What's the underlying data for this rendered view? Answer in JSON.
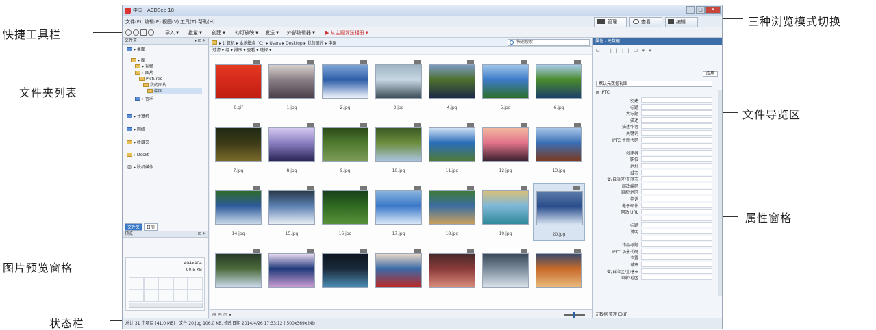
{
  "annotations": {
    "toolbar": "快捷工具栏",
    "folder_list": "文件夹列表",
    "preview_pane": "图片预览窗格",
    "status_bar": "状态栏",
    "view_mode": "三种浏览模式切换",
    "file_browser": "文件导览区",
    "properties": "属性窗格"
  },
  "window": {
    "title": "中国 - ACDSee 18",
    "minimize": "–",
    "maximize": "□",
    "close": "✕"
  },
  "menu": [
    "文件(F)",
    "编辑(E)",
    "视图(V)",
    "工具(T)",
    "帮助(H)"
  ],
  "modes": {
    "manage": "管理",
    "view": "查看",
    "edit": "编辑"
  },
  "toolbar": {
    "items": [
      "导入 ▾",
      "批量 ▾",
      "创建 ▾",
      "幻灯放映 ▾",
      "发送 ▾",
      "外部编辑器 ▾"
    ],
    "red_item": "▶ 从主题发送相册 ▾"
  },
  "left": {
    "folders_title": "文件夹",
    "tree": [
      "▸ 桌面",
      "▸ 库",
      "▸ 视频",
      "▸ 图片",
      "Pictures",
      "我的图片",
      "中国",
      "▸ 音乐",
      "▸ 计算机",
      "▸ 网络",
      "▸ 收藏夹",
      "▸ Deskt",
      "▸ 脱机媒体"
    ],
    "tabs": [
      "文件夹",
      "日历"
    ],
    "preview_title": "预览",
    "preview_meta_1": "404x404",
    "preview_meta_2": "90.5 KB"
  },
  "center": {
    "path": "▸ 计算机 ▸ 本地磁盘 (C:) ▸ Users ▸ Desktop ▸ 我的图片 ▸ 中国",
    "search_placeholder": "快速搜索",
    "filter": "过滤 ▾  组 ▾  排序 ▾  查看 ▾  选择 ▾",
    "status_icons": "⊞ ⊟ ⊡ ▾",
    "thumbnails": [
      {
        "caption": "0.gif",
        "c1": "#d62a1c",
        "c2": "#c01f12",
        "c3": "#e33a20"
      },
      {
        "caption": "1.jpg",
        "c1": "#8a7f86",
        "c2": "#4b3f4a",
        "c3": "#d6d0cc"
      },
      {
        "caption": "2.jpg",
        "c1": "#2d5ea8",
        "c2": "#f0f4fb",
        "c3": "#7fa5d8"
      },
      {
        "caption": "3.jpg",
        "c1": "#c8d7e3",
        "c2": "#3d4f59",
        "c3": "#9eb4c4"
      },
      {
        "caption": "4.jpg",
        "c1": "#4f6f2e",
        "c2": "#1a2a44",
        "c3": "#7a9ac2"
      },
      {
        "caption": "5.jpg",
        "c1": "#3c7bc8",
        "c2": "#2f6f2a",
        "c3": "#9fc4e8"
      },
      {
        "caption": "6.jpg",
        "c1": "#4a8a2c",
        "c2": "#1d3f6a",
        "c3": "#a8cbe8"
      },
      {
        "caption": "7.jpg",
        "c1": "#3b3a16",
        "c2": "#7a6a2b",
        "c3": "#1f2a14"
      },
      {
        "caption": "8.jpg",
        "c1": "#8c7fc2",
        "c2": "#2a2556",
        "c3": "#d4c9ef"
      },
      {
        "caption": "9.jpg",
        "c1": "#4f7a2e",
        "c2": "#7c9b58",
        "c3": "#2c4a1a"
      },
      {
        "caption": "10.jpg",
        "c1": "#6c8d3c",
        "c2": "#a9c3dd",
        "c3": "#3a5a24"
      },
      {
        "caption": "11.jpg",
        "c1": "#2a6db8",
        "c2": "#4f7a3a",
        "c3": "#cfe1f5"
      },
      {
        "caption": "12.jpg",
        "c1": "#e2738a",
        "c2": "#3d2230",
        "c3": "#f2b8a0"
      },
      {
        "caption": "13.jpg",
        "c1": "#3b6fb6",
        "c2": "#7a3a20",
        "c3": "#a8c6e8"
      },
      {
        "caption": "14.jpg",
        "c1": "#2d5a9a",
        "c2": "#c9d8ea",
        "c3": "#2e6a2a"
      },
      {
        "caption": "15.jpg",
        "c1": "#5a7fb0",
        "c2": "#e8eef6",
        "c3": "#2a3a4a"
      },
      {
        "caption": "16.jpg",
        "c1": "#2f6a22",
        "c2": "#58913a",
        "c3": "#19401a"
      },
      {
        "caption": "17.jpg",
        "c1": "#3a78c8",
        "c2": "#d9e8f7",
        "c3": "#8ab4e0"
      },
      {
        "caption": "18.jpg",
        "c1": "#3c6ea0",
        "c2": "#c9a060",
        "c3": "#3f7a3a"
      },
      {
        "caption": "19.jpg",
        "c1": "#7fb8d8",
        "c2": "#2f8a9a",
        "c3": "#d8c07a"
      },
      {
        "caption": "20.jpg",
        "c1": "#2a4e8c",
        "c2": "#d8e4f2",
        "c3": "#5a7aa8"
      },
      {
        "caption": "",
        "c1": "#4a6a3a",
        "c2": "#c8d8e8",
        "c3": "#2a3a2a"
      },
      {
        "caption": "",
        "c1": "#1f3a7a",
        "c2": "#c89ad0",
        "c3": "#e8d8f0"
      },
      {
        "caption": "",
        "c1": "#1a2a3a",
        "c2": "#4a8ab0",
        "c3": "#0d1620"
      },
      {
        "caption": "",
        "c1": "#3a6aa8",
        "c2": "#b82a2a",
        "c3": "#e8d8c8"
      },
      {
        "caption": "",
        "c1": "#8a3a3a",
        "c2": "#d88a7a",
        "c3": "#4a2a2a"
      },
      {
        "caption": "",
        "c1": "#7a8a9a",
        "c2": "#d8e0e8",
        "c3": "#3a4a5a"
      },
      {
        "caption": "",
        "c1": "#c86a2a",
        "c2": "#e8b87a",
        "c3": "#3a4a6a"
      }
    ]
  },
  "right": {
    "title": "属性 - 元数据",
    "tools": "⊡ | | | | | ☑ ▾ ▾",
    "apply": "应用",
    "dropdown": "默认元数据视图",
    "section": "⊟ IPTC",
    "rows": [
      "创建",
      "标题",
      "大标题",
      "描述",
      "描述作者",
      "关键词",
      "IPTC 主题代码",
      "",
      "创建者",
      "职位",
      "地址",
      "城市",
      "省/自治区/直辖市",
      "邮政编码",
      "国家/地区",
      "电话",
      "电子邮件",
      "网站 URL",
      "",
      "标题",
      "说明",
      "",
      "作品标题",
      "IPTC 场景代码",
      "位置",
      "城市",
      "省/自治区/直辖市",
      "国家/地区"
    ],
    "tabs": "元数据  整理  EXIF"
  },
  "status": "总计 31 个项目 (41.0 MB)  |  文件  20.jpg  106.0 KB, 修改日期 2014/4/26 17:33:12  |  500x369x24b"
}
